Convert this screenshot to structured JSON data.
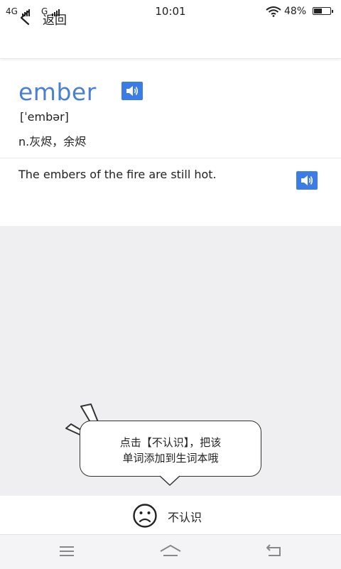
{
  "status_bar": {
    "signal1": "4G",
    "signal2": "G",
    "time": "10:01",
    "battery": "48%",
    "battery_level": 0.48,
    "icons": [
      "signal-icon",
      "wifi-icon",
      "battery-icon"
    ]
  },
  "header": {
    "back_label": "返回"
  },
  "word": {
    "text": "ember",
    "phonetic": "[ˈembər]",
    "meaning": "n.灰烬，余烬",
    "accent_color": "#4a7fd1",
    "button_color": "#3c7ce6"
  },
  "example": {
    "sentence": "The embers of the fire are still hot."
  },
  "tip": {
    "line1": "点击【不认识】，把该",
    "line2": "单词添加到生词本哦"
  },
  "action": {
    "unknown_label": "不认识"
  },
  "nav": {
    "icons": [
      "menu-icon",
      "home-icon",
      "back-nav-icon"
    ]
  }
}
